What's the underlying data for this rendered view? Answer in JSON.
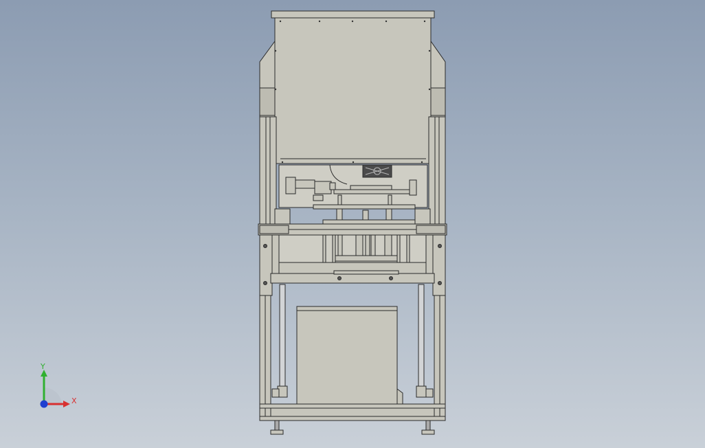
{
  "viewport": {
    "background_top": "#8c9cb2",
    "background_bottom": "#c9d0d8"
  },
  "model": {
    "fill_color": "#c7c6bc",
    "edge_color": "#2a2a2a",
    "rod_color": "#d2d4d6",
    "fan_color": "#4a4a4a"
  },
  "triad": {
    "x_label": "X",
    "y_label": "Y",
    "x_color": "#d83030",
    "y_color": "#30b030",
    "z_color": "#2040d0"
  }
}
